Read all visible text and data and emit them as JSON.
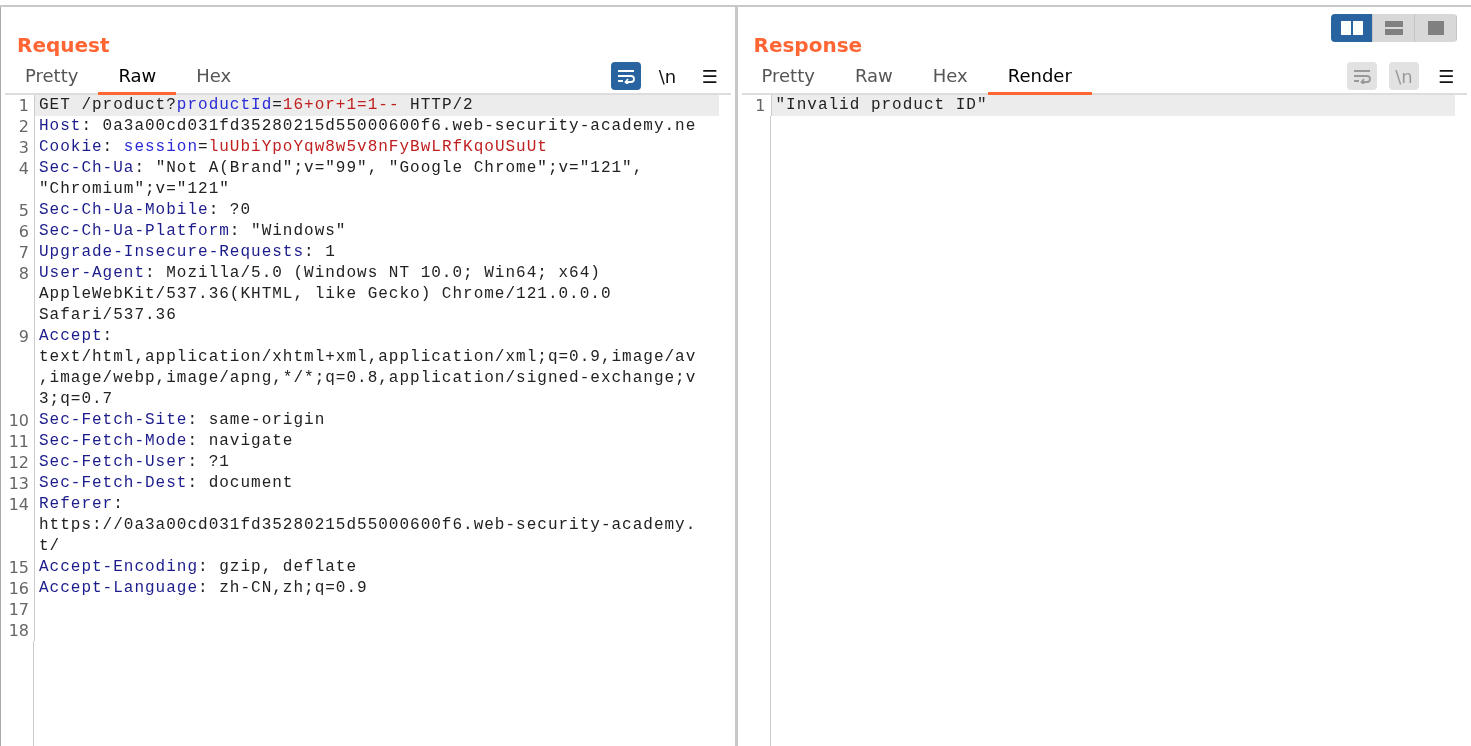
{
  "layout_toggle": [
    {
      "kind": "split",
      "selected": true
    },
    {
      "kind": "stacked",
      "selected": false
    },
    {
      "kind": "single",
      "selected": false
    }
  ],
  "panels": [
    {
      "title": "Request",
      "tabs": [
        {
          "label": "Pretty",
          "selected": false
        },
        {
          "label": "Raw",
          "selected": true
        },
        {
          "label": "Hex",
          "selected": false
        }
      ],
      "tools": [
        {
          "kind": "wrap",
          "selected": true,
          "disabled": false
        },
        {
          "kind": "newline",
          "label": "\\n",
          "selected": false,
          "disabled": false
        },
        {
          "kind": "menu",
          "label": "☰",
          "selected": false,
          "disabled": false
        }
      ],
      "lines": [
        {
          "number": "1",
          "highlighted": true,
          "rows": [
            [
              {
                "kind": "plain",
                "text": "GET /product?"
              },
              {
                "kind": "param",
                "text": "productId"
              },
              {
                "kind": "plain",
                "text": "="
              },
              {
                "kind": "value",
                "text": "16+or+1=1--"
              },
              {
                "kind": "plain",
                "text": " HTTP/2"
              }
            ]
          ]
        },
        {
          "number": "2",
          "highlighted": false,
          "rows": [
            [
              {
                "kind": "header",
                "text": "Host"
              },
              {
                "kind": "plain",
                "text": ": 0a3a00cd031fd35280215d55000600f6.web-security-academy.ne"
              }
            ]
          ]
        },
        {
          "number": "3",
          "highlighted": false,
          "rows": [
            [
              {
                "kind": "header",
                "text": "Cookie"
              },
              {
                "kind": "plain",
                "text": ": "
              },
              {
                "kind": "param",
                "text": "session"
              },
              {
                "kind": "plain",
                "text": "="
              },
              {
                "kind": "value",
                "text": "luUbiYpoYqw8w5v8nFyBwLRfKqoUSuUt"
              }
            ]
          ]
        },
        {
          "number": "4",
          "highlighted": false,
          "rows": [
            [
              {
                "kind": "header",
                "text": "Sec-Ch-Ua"
              },
              {
                "kind": "plain",
                "text": ": \"Not A(Brand\";v=\"99\", \"Google Chrome\";v=\"121\","
              }
            ],
            [
              {
                "kind": "plain",
                "text": "\"Chromium\";v=\"121\""
              }
            ]
          ]
        },
        {
          "number": "5",
          "highlighted": false,
          "rows": [
            [
              {
                "kind": "header",
                "text": "Sec-Ch-Ua-Mobile"
              },
              {
                "kind": "plain",
                "text": ": ?0"
              }
            ]
          ]
        },
        {
          "number": "6",
          "highlighted": false,
          "rows": [
            [
              {
                "kind": "header",
                "text": "Sec-Ch-Ua-Platform"
              },
              {
                "kind": "plain",
                "text": ": \"Windows\""
              }
            ]
          ]
        },
        {
          "number": "7",
          "highlighted": false,
          "rows": [
            [
              {
                "kind": "header",
                "text": "Upgrade-Insecure-Requests"
              },
              {
                "kind": "plain",
                "text": ": 1"
              }
            ]
          ]
        },
        {
          "number": "8",
          "highlighted": false,
          "rows": [
            [
              {
                "kind": "header",
                "text": "User-Agent"
              },
              {
                "kind": "plain",
                "text": ": Mozilla/5.0 (Windows NT 10.0; Win64; x64)"
              }
            ],
            [
              {
                "kind": "plain",
                "text": "AppleWebKit/537.36(KHTML, like Gecko) Chrome/121.0.0.0"
              }
            ],
            [
              {
                "kind": "plain",
                "text": "Safari/537.36"
              }
            ]
          ]
        },
        {
          "number": "9",
          "highlighted": false,
          "rows": [
            [
              {
                "kind": "header",
                "text": "Accept"
              },
              {
                "kind": "plain",
                "text": ":"
              }
            ],
            [
              {
                "kind": "plain",
                "text": "text/html,application/xhtml+xml,application/xml;q=0.9,image/av"
              }
            ],
            [
              {
                "kind": "plain",
                "text": ",image/webp,image/apng,*/*;q=0.8,application/signed-exchange;v"
              }
            ],
            [
              {
                "kind": "plain",
                "text": "3;q=0.7"
              }
            ]
          ]
        },
        {
          "number": "10",
          "highlighted": false,
          "rows": [
            [
              {
                "kind": "header",
                "text": "Sec-Fetch-Site"
              },
              {
                "kind": "plain",
                "text": ": same-origin"
              }
            ]
          ]
        },
        {
          "number": "11",
          "highlighted": false,
          "rows": [
            [
              {
                "kind": "header",
                "text": "Sec-Fetch-Mode"
              },
              {
                "kind": "plain",
                "text": ": navigate"
              }
            ]
          ]
        },
        {
          "number": "12",
          "highlighted": false,
          "rows": [
            [
              {
                "kind": "header",
                "text": "Sec-Fetch-User"
              },
              {
                "kind": "plain",
                "text": ": ?1"
              }
            ]
          ]
        },
        {
          "number": "13",
          "highlighted": false,
          "rows": [
            [
              {
                "kind": "header",
                "text": "Sec-Fetch-Dest"
              },
              {
                "kind": "plain",
                "text": ": document"
              }
            ]
          ]
        },
        {
          "number": "14",
          "highlighted": false,
          "rows": [
            [
              {
                "kind": "header",
                "text": "Referer"
              },
              {
                "kind": "plain",
                "text": ":"
              }
            ],
            [
              {
                "kind": "plain",
                "text": "https://0a3a00cd031fd35280215d55000600f6.web-security-academy."
              }
            ],
            [
              {
                "kind": "plain",
                "text": "t/"
              }
            ]
          ]
        },
        {
          "number": "15",
          "highlighted": false,
          "rows": [
            [
              {
                "kind": "header",
                "text": "Accept-Encoding"
              },
              {
                "kind": "plain",
                "text": ": gzip, deflate"
              }
            ]
          ]
        },
        {
          "number": "16",
          "highlighted": false,
          "rows": [
            [
              {
                "kind": "header",
                "text": "Accept-Language"
              },
              {
                "kind": "plain",
                "text": ": zh-CN,zh;q=0.9"
              }
            ]
          ]
        },
        {
          "number": "17",
          "highlighted": false
        },
        {
          "number": "18",
          "highlighted": false
        }
      ]
    },
    {
      "title": "Response",
      "tabs": [
        {
          "label": "Pretty",
          "selected": false
        },
        {
          "label": "Raw",
          "selected": false
        },
        {
          "label": "Hex",
          "selected": false
        },
        {
          "label": "Render",
          "selected": true
        }
      ],
      "tools": [
        {
          "kind": "wrap",
          "selected": false,
          "disabled": true
        },
        {
          "kind": "newline",
          "label": "\\n",
          "selected": false,
          "disabled": true
        },
        {
          "kind": "menu",
          "label": "☰",
          "selected": false,
          "disabled": false
        }
      ],
      "lines": [
        {
          "number": "1",
          "highlighted": true,
          "rows": [
            [
              {
                "kind": "plain",
                "text": "\"Invalid product ID\""
              }
            ]
          ]
        }
      ]
    }
  ]
}
